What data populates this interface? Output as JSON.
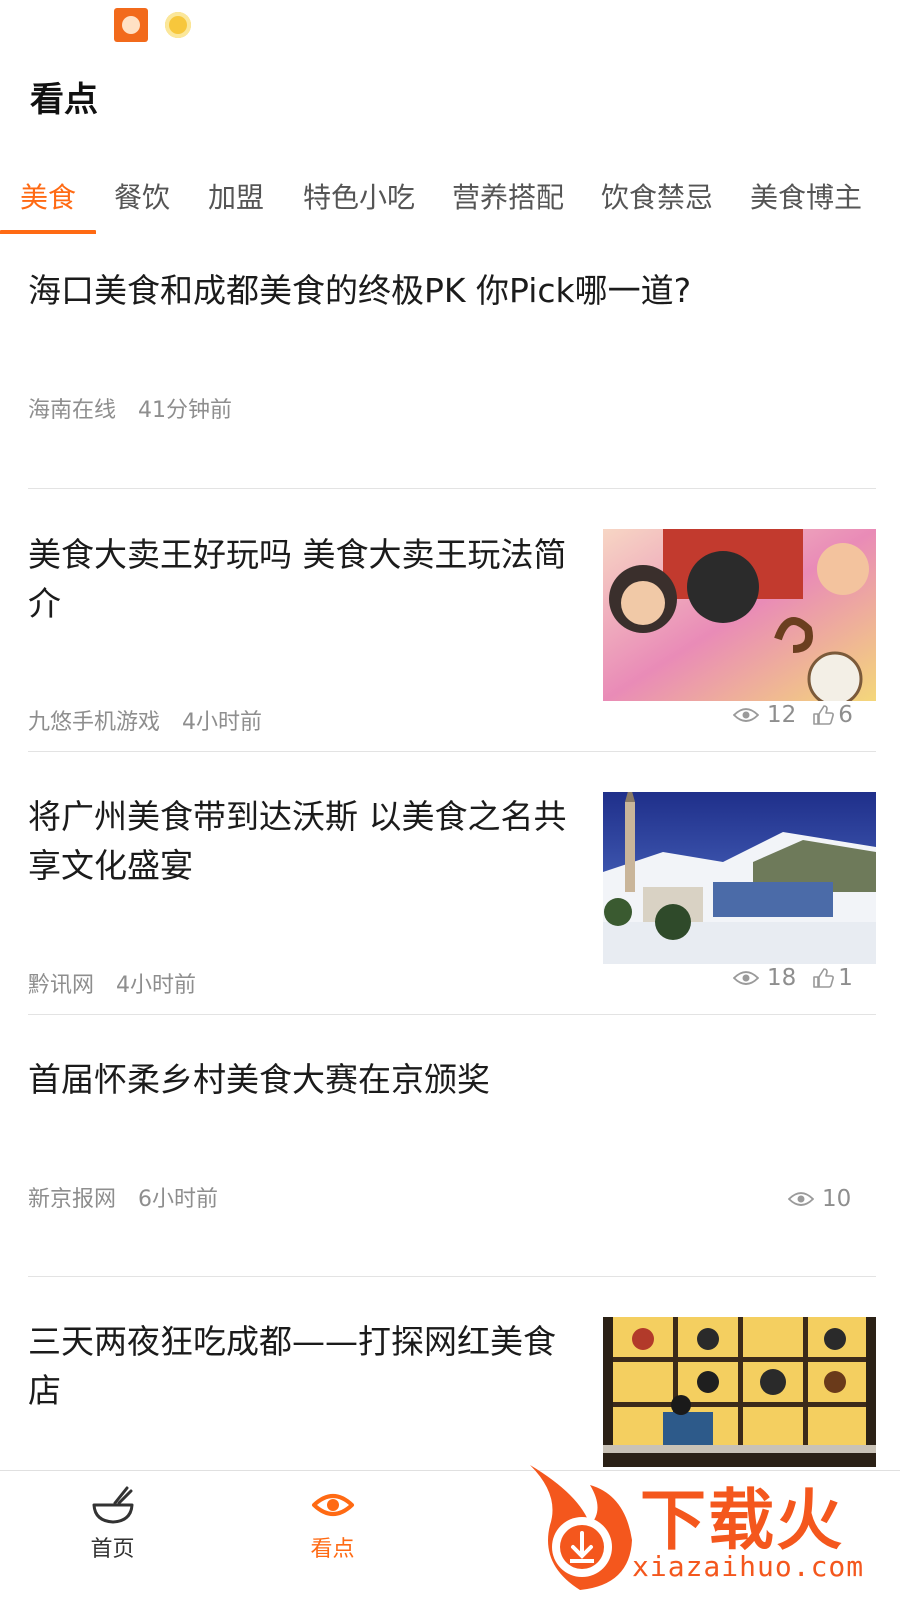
{
  "header": {
    "title": "看点"
  },
  "tabs": [
    {
      "label": "美食",
      "active": true
    },
    {
      "label": "餐饮"
    },
    {
      "label": "加盟"
    },
    {
      "label": "特色小吃"
    },
    {
      "label": "营养搭配"
    },
    {
      "label": "饮食禁忌"
    },
    {
      "label": "美食博主"
    }
  ],
  "articles": [
    {
      "title": "海口美食和成都美食的终极PK 你Pick哪一道?",
      "source": "海南在线",
      "time": "41分钟前"
    },
    {
      "title": "美食大卖王好玩吗 美食大卖王玩法简介",
      "source": "九悠手机游戏",
      "time": "4小时前",
      "views": "12",
      "likes": "6"
    },
    {
      "title": "将广州美食带到达沃斯 以美食之名共享文化盛宴",
      "source": "黔讯网",
      "time": "4小时前",
      "views": "18",
      "likes": "1"
    },
    {
      "title": "首届怀柔乡村美食大赛在京颁奖",
      "source": "新京报网",
      "time": "6小时前",
      "views": "10"
    },
    {
      "title": "三天两夜狂吃成都——打探网红美食店"
    }
  ],
  "tabbar": [
    {
      "label": "首页",
      "icon": "bowl-icon"
    },
    {
      "label": "看点",
      "icon": "eye-icon",
      "active": true
    }
  ],
  "watermark": {
    "brand": "下载火",
    "url": "xiazaihuo.com"
  },
  "colors": {
    "accent": "#ff6a13",
    "muted": "#8e8e8e",
    "divider": "#e3e3e3"
  }
}
